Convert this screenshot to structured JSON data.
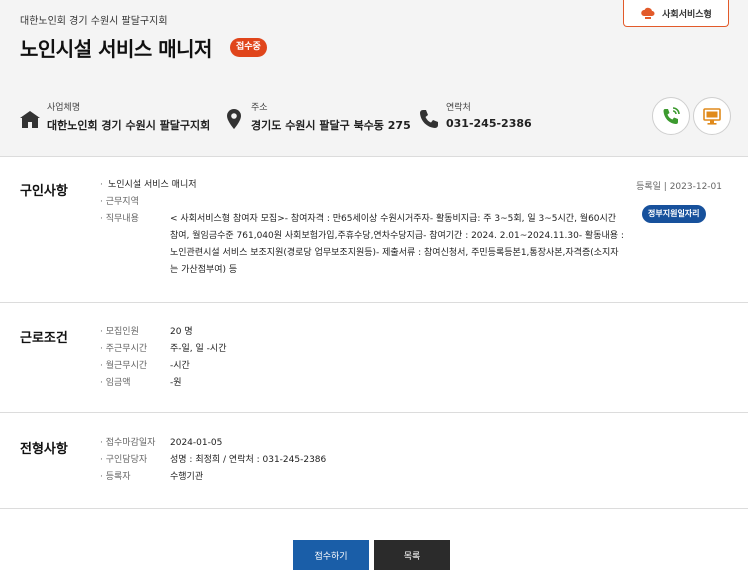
{
  "header": {
    "org": "대한노인회 경기 수원시 팔달구지회",
    "title": "노인시설 서비스 매니저",
    "status_badge": "접수중",
    "service_button": "사회서비스형",
    "info": [
      {
        "label": "사업체명",
        "value": "대한노인회 경기 수원시 팔달구지회",
        "icon": "building-icon"
      },
      {
        "label": "주소",
        "value": "경기도 수원시 팔달구 북수동 275",
        "icon": "location-pin-icon"
      },
      {
        "label": "연락처",
        "value": "031-245-2386",
        "icon": "phone-icon"
      }
    ],
    "action_icons": [
      "phone-call-icon",
      "monitor-icon"
    ]
  },
  "colors": {
    "accent_orange": "#e0451b",
    "primary_blue": "#1a5ea8",
    "gov_blue": "#17519c",
    "icon_green": "#3c9a2f",
    "icon_orange": "#e08a1b"
  },
  "recruit": {
    "title": "구인사항",
    "registered": "등록일  |  2023-12-01",
    "gov_badge": "정부지원일자리",
    "rows": [
      {
        "key": "",
        "value": "노인시설 서비스 매니저"
      },
      {
        "key": "근무지역",
        "value": ""
      },
      {
        "key": "직무내용",
        "value": "< 사회서비스형 참여자 모집>- 참여자격 : 만65세이상 수원시거주자- 활동비지급: 주 3~5회, 일 3~5시간, 월60시간 참여, 월임금수준 761,040원              사회보험가입,주휴수당,연차수당지급- 참여기간 : 2024. 2.01~2024.11.30- 활동내용 : 노인관련시설 서비스 보조지원(경로당 업무보조지원등)- 제출서류 : 참여신청서, 주민등록등본1,통장사본,자격증(소지자는 가산점부여) 등"
      }
    ]
  },
  "conditions": {
    "title": "근로조건",
    "rows": [
      {
        "key": "모집인원",
        "value": "20 명"
      },
      {
        "key": "주근무시간",
        "value": "주-일, 일 -시간"
      },
      {
        "key": "월근무시간",
        "value": "-시간"
      },
      {
        "key": "임금액",
        "value": "-원"
      }
    ]
  },
  "selection": {
    "title": "전형사항",
    "rows": [
      {
        "key": "접수마감일자",
        "value": "2024-01-05"
      },
      {
        "key": "구인담당자",
        "value": "성명 : 최정희 / 연락처 : 031-245-2386"
      },
      {
        "key": "등록자",
        "value": "수행기관"
      }
    ]
  },
  "buttons": {
    "apply": "접수하기",
    "list": "목록"
  }
}
